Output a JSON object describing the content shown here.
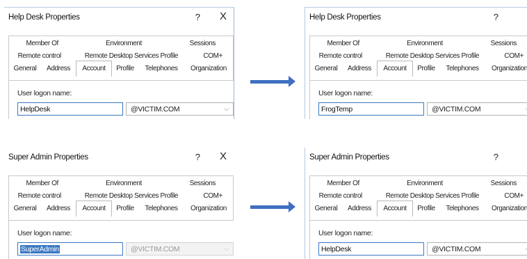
{
  "tabs": {
    "row1": [
      "Member Of",
      "Environment",
      "Sessions"
    ],
    "row2": [
      "Remote control",
      "Remote Desktop Services Profile",
      "COM+"
    ],
    "row3": [
      "General",
      "Address",
      "Account",
      "Profile",
      "Telephones",
      "Organization"
    ],
    "selected": "Account"
  },
  "dialogs": {
    "top_before": {
      "title": "Help Desk Properties",
      "logon_label": "User logon name:",
      "logon_value": "HelpDesk",
      "domain": "@VICTIM.COM"
    },
    "top_after": {
      "title": "Help Desk Properties",
      "logon_label": "User logon name:",
      "logon_value": "FrogTemp",
      "domain": "@VICTIM.COM"
    },
    "bottom_before": {
      "title": "Super Admin Properties",
      "logon_label": "User logon name:",
      "logon_value": "SuperAdmin",
      "domain": "@VICTIM.COM"
    },
    "bottom_after": {
      "title": "Super Admin Properties",
      "logon_label": "User logon name:",
      "logon_value": "HelpDesk",
      "domain": "@VICTIM.COM"
    }
  },
  "controls": {
    "help": "?",
    "close": "X",
    "chevron": "⌵"
  },
  "colors": {
    "arrow": "#3f6fc0",
    "selection": "#3a78c3"
  },
  "icons": [
    "arrow-right-icon",
    "chevron-down-icon"
  ]
}
